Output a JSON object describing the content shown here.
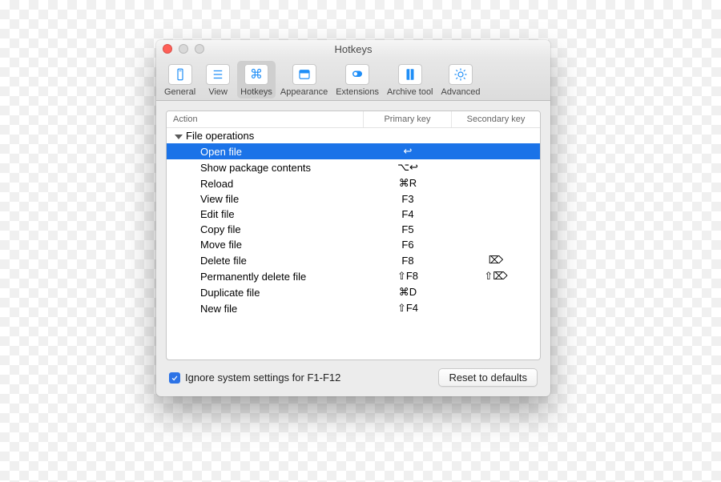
{
  "window": {
    "title": "Hotkeys"
  },
  "toolbar": {
    "items": [
      {
        "id": "general",
        "label": "General"
      },
      {
        "id": "view",
        "label": "View"
      },
      {
        "id": "hotkeys",
        "label": "Hotkeys"
      },
      {
        "id": "appearance",
        "label": "Appearance"
      },
      {
        "id": "extensions",
        "label": "Extensions"
      },
      {
        "id": "archive",
        "label": "Archive tool"
      },
      {
        "id": "advanced",
        "label": "Advanced"
      }
    ],
    "selected": "hotkeys"
  },
  "table": {
    "columns": {
      "action": "Action",
      "primary": "Primary key",
      "secondary": "Secondary key"
    },
    "group_label": "File operations",
    "rows": [
      {
        "action": "Open file",
        "primary": "↩",
        "secondary": "",
        "selected": true
      },
      {
        "action": "Show package contents",
        "primary": "⌥↩",
        "secondary": "",
        "selected": false
      },
      {
        "action": "Reload",
        "primary": "⌘R",
        "secondary": "",
        "selected": false
      },
      {
        "action": "View file",
        "primary": "F3",
        "secondary": "",
        "selected": false
      },
      {
        "action": "Edit file",
        "primary": "F4",
        "secondary": "",
        "selected": false
      },
      {
        "action": "Copy file",
        "primary": "F5",
        "secondary": "",
        "selected": false
      },
      {
        "action": "Move file",
        "primary": "F6",
        "secondary": "",
        "selected": false
      },
      {
        "action": "Delete file",
        "primary": "F8",
        "secondary": "⌦",
        "selected": false
      },
      {
        "action": "Permanently delete file",
        "primary": "⇧F8",
        "secondary": "⇧⌦",
        "selected": false
      },
      {
        "action": "Duplicate file",
        "primary": "⌘D",
        "secondary": "",
        "selected": false
      },
      {
        "action": "New file",
        "primary": "⇧F4",
        "secondary": "",
        "selected": false
      }
    ]
  },
  "footer": {
    "checkbox_label": "Ignore system settings for F1-F12",
    "checkbox_checked": true,
    "reset_label": "Reset to defaults"
  }
}
